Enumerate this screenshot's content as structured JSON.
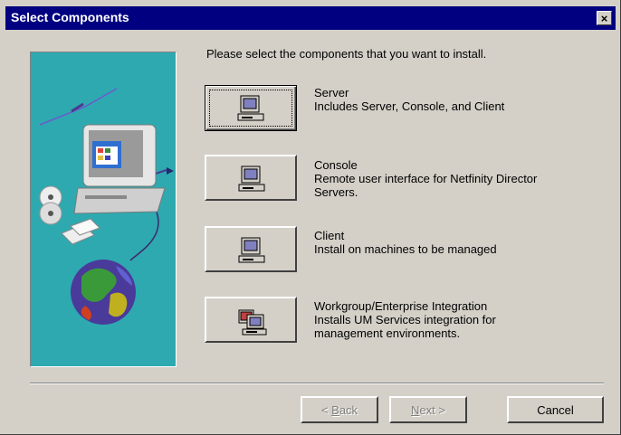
{
  "window": {
    "title": "Select Components",
    "close_label": "×"
  },
  "intro": "Please select the components that you want to install.",
  "options": [
    {
      "name": "Server",
      "desc": [
        "Includes Server, Console, and Client"
      ],
      "icon": "computer-icon",
      "focused": true
    },
    {
      "name": "Console",
      "desc": [
        "Remote user interface for Netfinity Director",
        "Servers."
      ],
      "icon": "computer-icon"
    },
    {
      "name": "Client",
      "desc": [
        "Install on machines to be managed"
      ],
      "icon": "computer-icon"
    },
    {
      "name": "Workgroup/Enterprise Integration",
      "desc": [
        "Installs UM Services integration for",
        "management environments."
      ],
      "icon": "network-computers-icon"
    }
  ],
  "buttons": {
    "back": {
      "prefix": "< ",
      "mnemonic": "B",
      "rest": "ack",
      "enabled": false
    },
    "next": {
      "mnemonic": "N",
      "rest": "ext >",
      "enabled": false
    },
    "cancel": {
      "label": "Cancel",
      "enabled": true
    }
  },
  "colors": {
    "titlebar": "#000080",
    "art_background": "#2ea9b0",
    "dialog": "#d4d0c8"
  }
}
